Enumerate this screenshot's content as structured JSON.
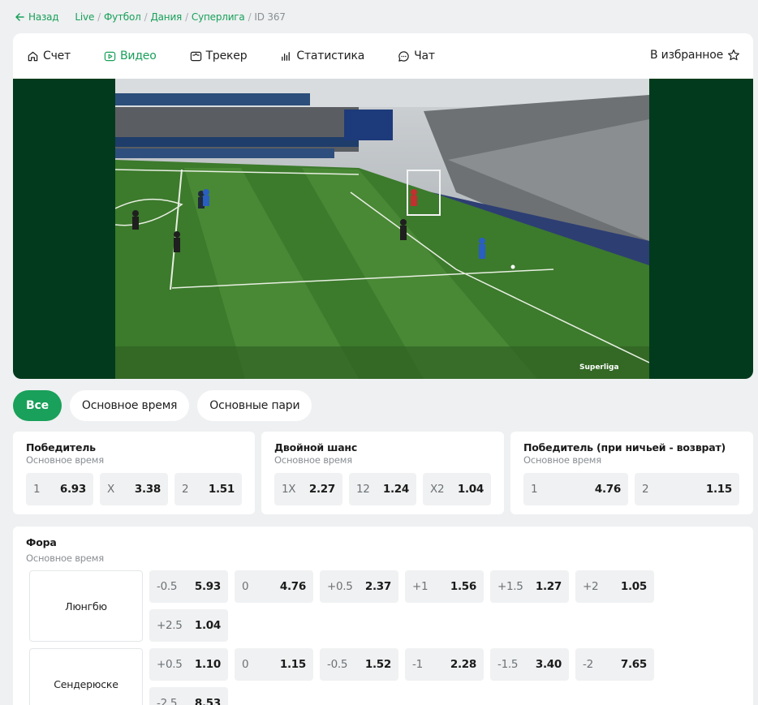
{
  "breadcrumb": {
    "back": "Назад",
    "items": [
      "Live",
      "Футбол",
      "Дания",
      "Суперлига"
    ],
    "current": "ID 367"
  },
  "tabs": [
    {
      "label": "Счет",
      "icon": "home-icon"
    },
    {
      "label": "Видео",
      "icon": "video-play-icon",
      "active": true
    },
    {
      "label": "Трекер",
      "icon": "tracker-icon"
    },
    {
      "label": "Статистика",
      "icon": "stats-bars-icon"
    },
    {
      "label": "Чат",
      "icon": "chat-bubble-icon"
    }
  ],
  "favorite": {
    "label": "В избранное",
    "icon": "star-icon"
  },
  "video": {
    "watermark": "Superliga"
  },
  "filters": [
    {
      "label": "Все",
      "active": true
    },
    {
      "label": "Основное время"
    },
    {
      "label": "Основные пари"
    }
  ],
  "markets": [
    {
      "title": "Победитель",
      "subtitle": "Основное время",
      "odds": [
        {
          "label": "1",
          "value": "6.93"
        },
        {
          "label": "X",
          "value": "3.38"
        },
        {
          "label": "2",
          "value": "1.51"
        }
      ]
    },
    {
      "title": "Двойной шанс",
      "subtitle": "Основное время",
      "odds": [
        {
          "label": "1X",
          "value": "2.27"
        },
        {
          "label": "12",
          "value": "1.24"
        },
        {
          "label": "X2",
          "value": "1.04"
        }
      ]
    },
    {
      "title": "Победитель (при ничьей - возврат)",
      "subtitle": "Основное время",
      "odds": [
        {
          "label": "1",
          "value": "4.76"
        },
        {
          "label": "2",
          "value": "1.15"
        }
      ]
    }
  ],
  "handicap": {
    "title": "Фора",
    "subtitle": "Основное время",
    "teams": [
      {
        "name": "Люнгбю",
        "odds": [
          {
            "label": "-0.5",
            "value": "5.93"
          },
          {
            "label": "0",
            "value": "4.76"
          },
          {
            "label": "+0.5",
            "value": "2.37"
          },
          {
            "label": "+1",
            "value": "1.56"
          },
          {
            "label": "+1.5",
            "value": "1.27"
          },
          {
            "label": "+2",
            "value": "1.05"
          },
          {
            "label": "+2.5",
            "value": "1.04"
          }
        ]
      },
      {
        "name": "Сендерюске",
        "odds": [
          {
            "label": "+0.5",
            "value": "1.10"
          },
          {
            "label": "0",
            "value": "1.15"
          },
          {
            "label": "-0.5",
            "value": "1.52"
          },
          {
            "label": "-1",
            "value": "2.28"
          },
          {
            "label": "-1.5",
            "value": "3.40"
          },
          {
            "label": "-2",
            "value": "7.65"
          },
          {
            "label": "-2.5",
            "value": "8.53"
          }
        ]
      }
    ]
  },
  "colors": {
    "accent": "#19a05a",
    "video_bg": "#013a1c",
    "page_bg": "#eef0f1",
    "odd_bg": "#f0f1f2"
  }
}
